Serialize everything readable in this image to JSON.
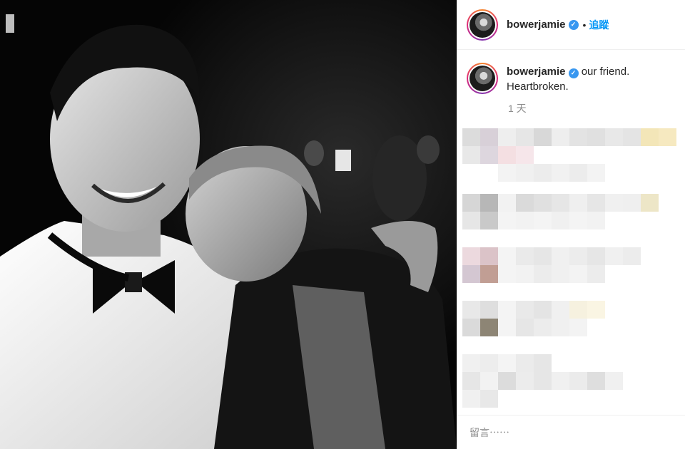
{
  "post": {
    "username": "bowerjamie",
    "follow_label": "追蹤",
    "separator": "•",
    "verified_glyph": "✓",
    "caption_line1": "our friend.",
    "caption_line2": "Heartbroken.",
    "timestamp": "1 天",
    "comment_placeholder": "留言⋯⋯"
  },
  "colors": {
    "link_blue": "#0095f6",
    "verified_blue": "#3897f0",
    "text": "#262626",
    "muted": "#8e8e8e"
  },
  "icons": [
    "verified-badge-icon",
    "avatar-icon"
  ]
}
